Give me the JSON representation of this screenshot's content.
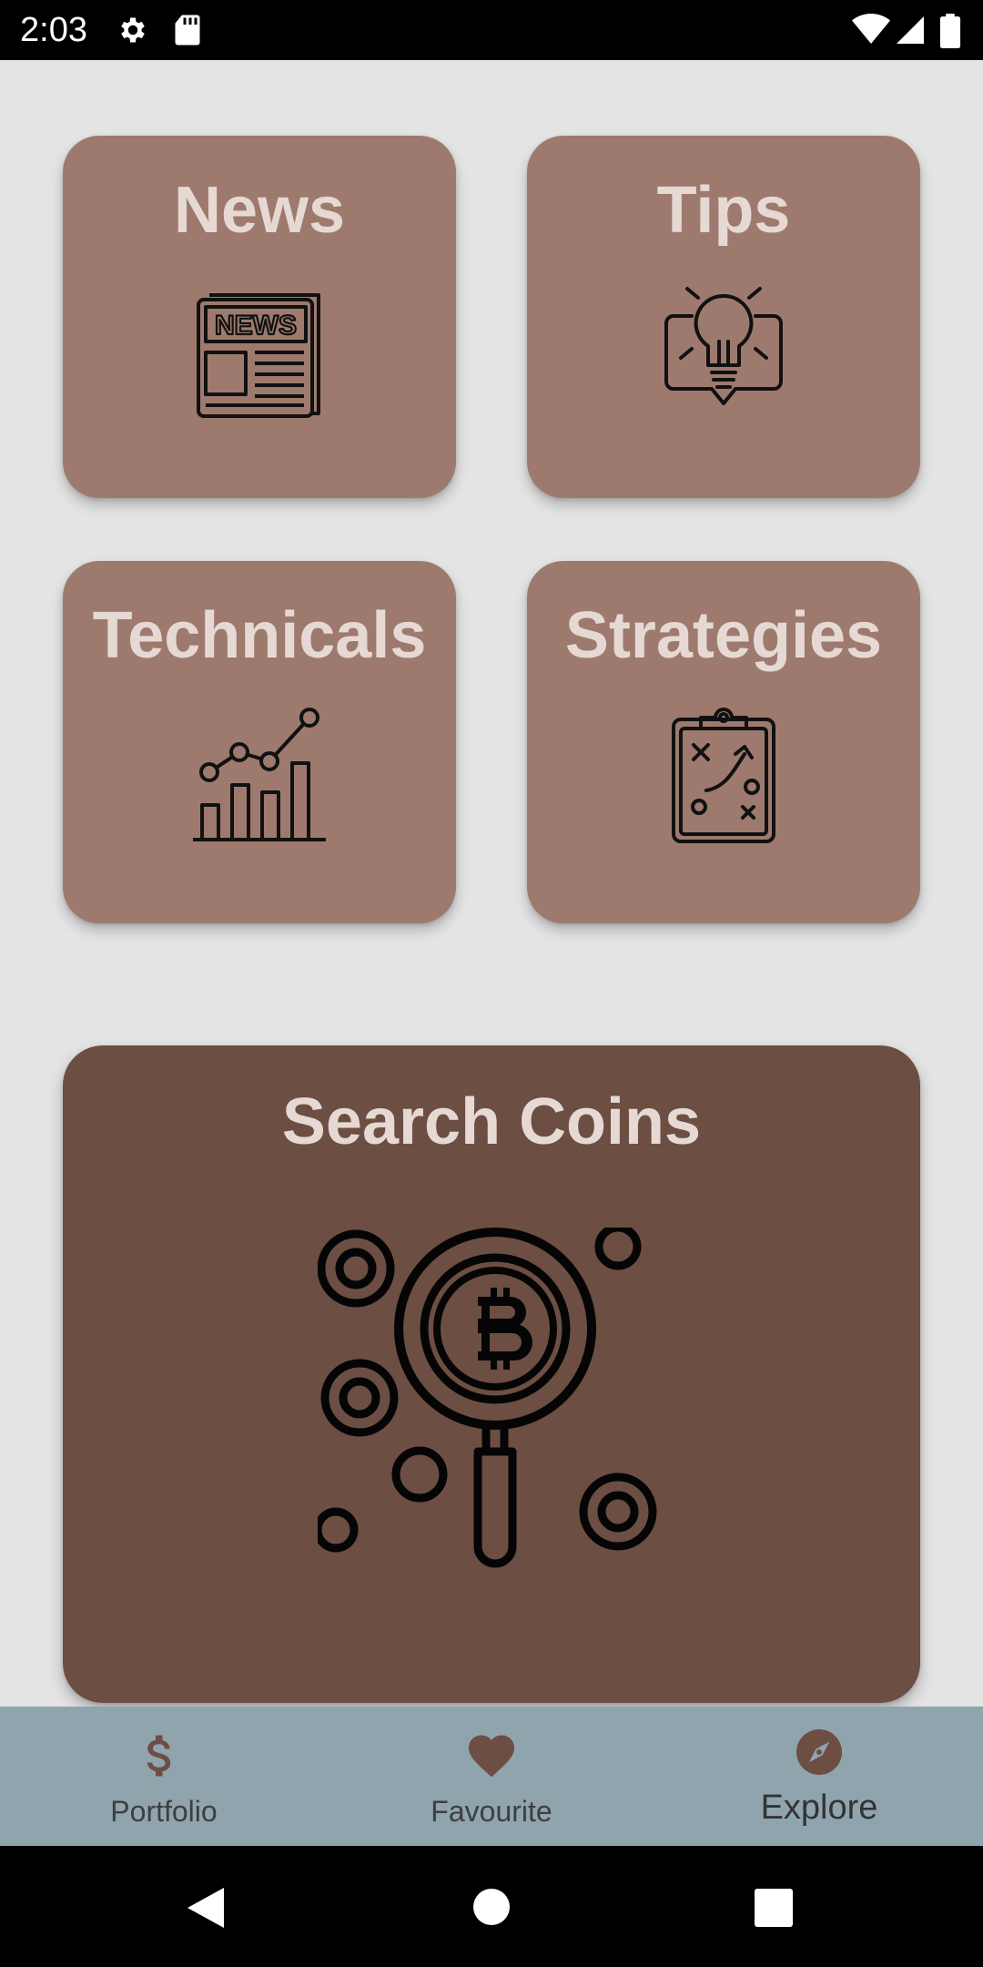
{
  "status_bar": {
    "time": "2:03",
    "icons": [
      "settings-gear-icon",
      "sd-card-icon",
      "wifi-icon",
      "cell-signal-icon",
      "battery-icon"
    ]
  },
  "tiles": {
    "news": {
      "label": "News",
      "icon": "newspaper-icon"
    },
    "tips": {
      "label": "Tips",
      "icon": "lightbulb-icon"
    },
    "technicals": {
      "label": "Technicals",
      "icon": "bar-line-chart-icon"
    },
    "strategies": {
      "label": "Strategies",
      "icon": "clipboard-strategy-icon"
    },
    "search": {
      "label": "Search Coins",
      "icon": "bitcoin-search-icon"
    }
  },
  "bottom_nav": {
    "items": [
      {
        "label": "Portfolio",
        "icon": "dollar-icon",
        "active": false
      },
      {
        "label": "Favourite",
        "icon": "heart-icon",
        "active": false
      },
      {
        "label": "Explore",
        "icon": "compass-icon",
        "active": true
      }
    ]
  },
  "colors": {
    "background": "#e4e4e4",
    "tile": "#9e7a6e",
    "tile_dark": "#6c4e43",
    "tile_text": "#e6d9d4",
    "nav_background": "#90a4ae",
    "nav_icon": "#6c4e43"
  }
}
